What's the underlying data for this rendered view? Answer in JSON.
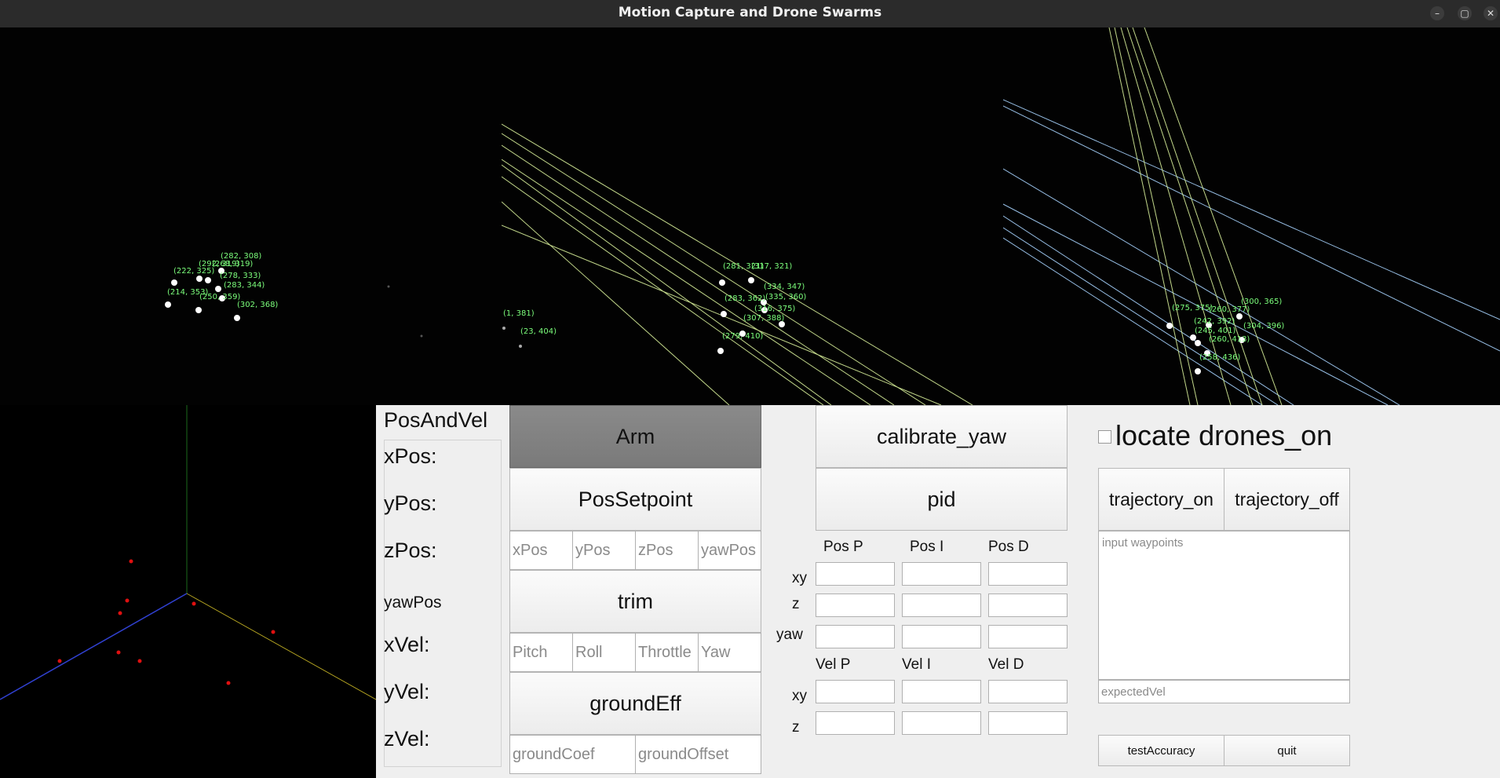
{
  "window": {
    "title": "Motion Capture and Drone Swarms",
    "controls": [
      "–",
      "▢",
      "✕"
    ]
  },
  "colors": {
    "label_green": "#7cff7c",
    "ray_green": "#d8f09a",
    "ray_blue": "#a8d4ff",
    "axis_blue": "#3040d0",
    "axis_yellow": "#b0a020",
    "axis_green": "#1c6a1c",
    "point_red": "#e01010"
  },
  "camera_views": [
    {
      "labels": [
        "(282, 308)",
        "(292, 319)",
        "(268, 319)",
        "(222, 325)",
        "(278, 333)",
        "(283, 344)",
        "(214, 353)",
        "(250, 359)",
        "(302, 368)"
      ]
    },
    {
      "labels": [
        "(281, 321)",
        "(317, 321)",
        "(334, 347)",
        "(283, 362)",
        "(335, 360)",
        "(316, 375)",
        "(307, 388)",
        "(279, 410)",
        "(1, 381)",
        "(23, 404)"
      ]
    },
    {
      "labels": [
        "(300, 365)",
        "(275, 375)",
        "(260, 377)",
        "(304, 396)",
        "(242, 392)",
        "(245, 401)",
        "(260, 413)",
        "(258, 436)"
      ]
    }
  ],
  "state": {
    "title": "PosAndVel",
    "rows": [
      "xPos:",
      "yPos:",
      "zPos:",
      "yawPos",
      "xVel:",
      "yVel:",
      "zVel:"
    ]
  },
  "controls": {
    "arm": "Arm",
    "pos_setpoint": "PosSetpoint",
    "pos_fields": [
      "xPos",
      "yPos",
      "zPos",
      "yawPos"
    ],
    "trim": "trim",
    "trim_fields": [
      "Pitch",
      "Roll",
      "Throttle",
      "Yaw"
    ],
    "ground_eff": "groundEff",
    "ground_fields": [
      "groundCoef",
      "groundOffset"
    ]
  },
  "pid": {
    "calibrate": "calibrate_yaw",
    "pid_button": "pid",
    "pos_headers": [
      "Pos P",
      "Pos I",
      "Pos D"
    ],
    "pos_rows": [
      "xy",
      "z",
      "yaw"
    ],
    "vel_headers": [
      "Vel P",
      "Vel I",
      "Vel D"
    ],
    "vel_rows": [
      "xy",
      "z"
    ]
  },
  "trajectory": {
    "locate_label": "locate drones_on",
    "locate_checked": false,
    "traj_on": "trajectory_on",
    "traj_off": "trajectory_off",
    "waypoints_placeholder": "input waypoints",
    "expected_vel_placeholder": "expectedVel",
    "test_accuracy": "testAccuracy",
    "quit": "quit"
  }
}
